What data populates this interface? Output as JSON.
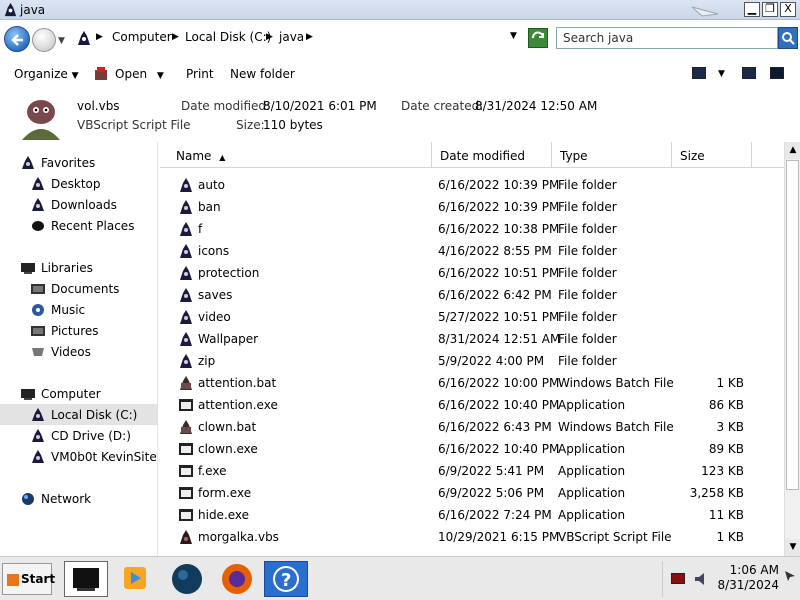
{
  "window": {
    "title": "java",
    "minimize_label": "▁",
    "restore_label": "❐",
    "close_label": "X"
  },
  "address": {
    "crumbs": [
      "Computer",
      "Local Disk (C:)",
      "java"
    ],
    "search_placeholder": "Search java"
  },
  "toolbar": {
    "organize": "Organize",
    "open": "Open",
    "print": "Print",
    "new_folder": "New folder"
  },
  "details": {
    "name": "vol.vbs",
    "type": "VBScript Script File",
    "date_modified_label": "Date modified:",
    "date_modified": "8/10/2021 6:01 PM",
    "date_created_label": "Date created:",
    "date_created": "8/31/2024 12:50 AM",
    "size_label": "Size:",
    "size": "110 bytes"
  },
  "nav": {
    "items": [
      {
        "label": "Favorites",
        "icon": "star-icon",
        "level": 0
      },
      {
        "label": "Desktop",
        "icon": "desktop-icon",
        "level": 1
      },
      {
        "label": "Downloads",
        "icon": "downloads-icon",
        "level": 1
      },
      {
        "label": "Recent Places",
        "icon": "recent-places-icon",
        "level": 1
      },
      {
        "label": "Libraries",
        "icon": "libraries-icon",
        "level": 0
      },
      {
        "label": "Documents",
        "icon": "documents-icon",
        "level": 1
      },
      {
        "label": "Music",
        "icon": "music-icon",
        "level": 1
      },
      {
        "label": "Pictures",
        "icon": "pictures-icon",
        "level": 1
      },
      {
        "label": "Videos",
        "icon": "videos-icon",
        "level": 1
      },
      {
        "label": "Computer",
        "icon": "computer-icon",
        "level": 0
      },
      {
        "label": "Local Disk (C:)",
        "icon": "local-disk-icon",
        "level": 1,
        "selected": true
      },
      {
        "label": "CD Drive (D:)",
        "icon": "cd-drive-icon",
        "level": 1
      },
      {
        "label": "VM0b0t KevinSite",
        "icon": "network-drive-icon",
        "level": 1
      },
      {
        "label": "Network",
        "icon": "network-icon",
        "level": 0
      }
    ]
  },
  "columns": {
    "name": "Name",
    "date": "Date modified",
    "type": "Type",
    "size": "Size"
  },
  "files": [
    {
      "name": "auto",
      "date": "6/16/2022 10:39 PM",
      "type": "File folder",
      "size": "",
      "icon": "folder-icon"
    },
    {
      "name": "ban",
      "date": "6/16/2022 10:39 PM",
      "type": "File folder",
      "size": "",
      "icon": "folder-icon"
    },
    {
      "name": "f",
      "date": "6/16/2022 10:38 PM",
      "type": "File folder",
      "size": "",
      "icon": "folder-icon"
    },
    {
      "name": "icons",
      "date": "4/16/2022 8:55 PM",
      "type": "File folder",
      "size": "",
      "icon": "folder-icon"
    },
    {
      "name": "protection",
      "date": "6/16/2022 10:51 PM",
      "type": "File folder",
      "size": "",
      "icon": "folder-icon"
    },
    {
      "name": "saves",
      "date": "6/16/2022 6:42 PM",
      "type": "File folder",
      "size": "",
      "icon": "folder-icon"
    },
    {
      "name": "video",
      "date": "5/27/2022 10:51 PM",
      "type": "File folder",
      "size": "",
      "icon": "folder-icon"
    },
    {
      "name": "Wallpaper",
      "date": "8/31/2024 12:51 AM",
      "type": "File folder",
      "size": "",
      "icon": "folder-icon"
    },
    {
      "name": "zip",
      "date": "5/9/2022 4:00 PM",
      "type": "File folder",
      "size": "",
      "icon": "folder-icon"
    },
    {
      "name": "attention.bat",
      "date": "6/16/2022 10:00 PM",
      "type": "Windows Batch File",
      "size": "1 KB",
      "icon": "batch-file-icon"
    },
    {
      "name": "attention.exe",
      "date": "6/16/2022 10:40 PM",
      "type": "Application",
      "size": "86 KB",
      "icon": "application-icon"
    },
    {
      "name": "clown.bat",
      "date": "6/16/2022 6:43 PM",
      "type": "Windows Batch File",
      "size": "3 KB",
      "icon": "batch-file-icon"
    },
    {
      "name": "clown.exe",
      "date": "6/16/2022 10:40 PM",
      "type": "Application",
      "size": "89 KB",
      "icon": "application-icon"
    },
    {
      "name": "f.exe",
      "date": "6/9/2022 5:41 PM",
      "type": "Application",
      "size": "123 KB",
      "icon": "application-icon"
    },
    {
      "name": "form.exe",
      "date": "6/9/2022 5:06 PM",
      "type": "Application",
      "size": "3,258 KB",
      "icon": "application-icon"
    },
    {
      "name": "hide.exe",
      "date": "6/16/2022 7:24 PM",
      "type": "Application",
      "size": "11 KB",
      "icon": "application-icon"
    },
    {
      "name": "morgalka.vbs",
      "date": "10/29/2021 6:15 PM",
      "type": "VBScript Script File",
      "size": "1 KB",
      "icon": "script-file-icon"
    }
  ],
  "taskbar": {
    "start_label": "Start",
    "apps": [
      {
        "icon": "computer-app-icon",
        "active": true
      },
      {
        "icon": "media-player-icon",
        "active": false
      },
      {
        "icon": "globe-icon",
        "active": false
      },
      {
        "icon": "firefox-icon",
        "active": false
      },
      {
        "icon": "help-icon",
        "active": false
      }
    ],
    "time": "1:06 AM",
    "date": "8/31/2024"
  }
}
